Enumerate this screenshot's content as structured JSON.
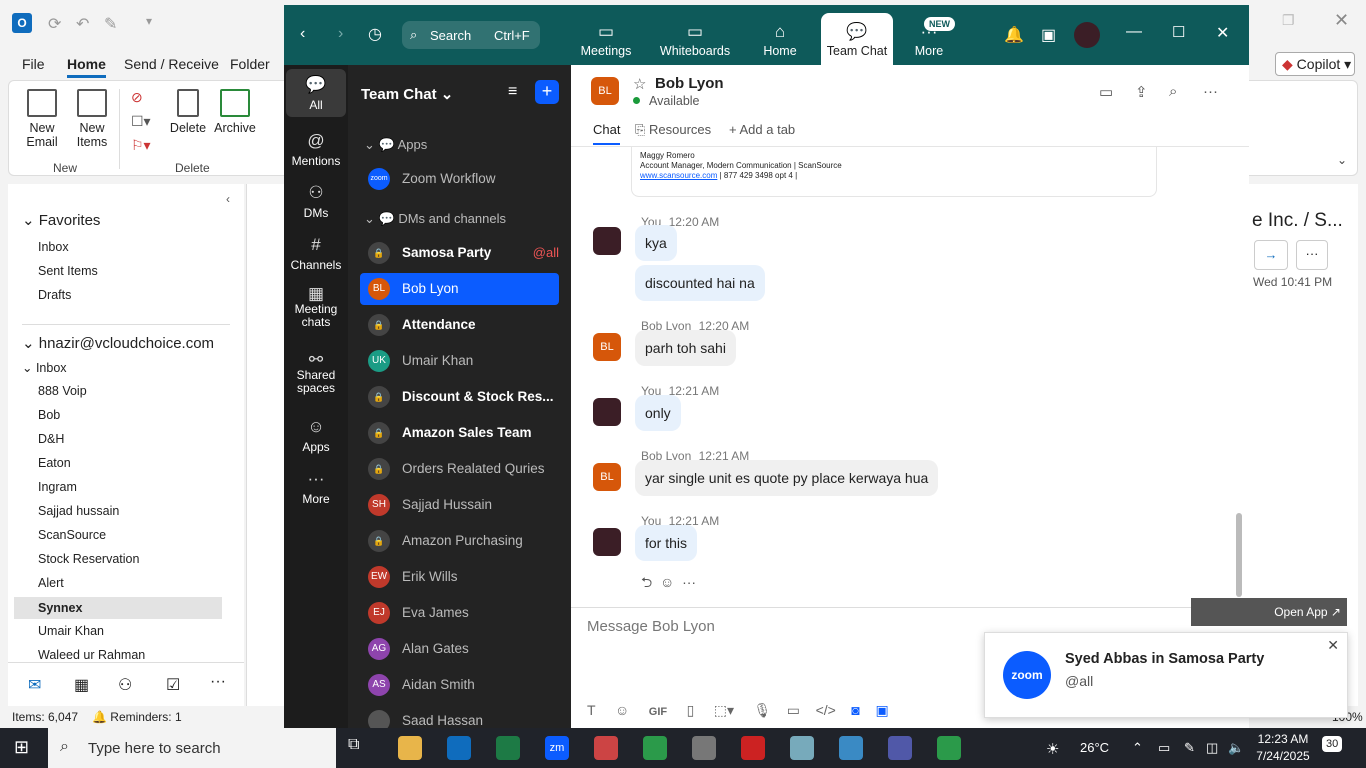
{
  "outlook": {
    "menu": [
      "File",
      "Home",
      "Send / Receive",
      "Folder"
    ],
    "ribbon": {
      "new_email": "New\nEmail",
      "new_items": "New\nItems",
      "delete": "Delete",
      "archive": "Archive",
      "group_new": "New",
      "group_delete": "Delete"
    },
    "copilot": "Copilot",
    "favorites_label": "Favorites",
    "favorites": [
      "Inbox",
      "Sent Items",
      "Drafts"
    ],
    "account": "hnazir@vcloudchoice.com",
    "inbox_label": "Inbox",
    "folders": [
      "888 Voip",
      "Bob",
      "D&H",
      "Eaton",
      "Ingram",
      "Sajjad hussain",
      "ScanSource",
      "Stock Reservation",
      "Alert",
      "Synnex",
      "Umair Khan",
      "Waleed ur Rahman"
    ],
    "selected_folder": "Synnex",
    "right_title": "e Inc. / S...",
    "right_date": "Wed 10:41 PM",
    "status_items": "Items: 6,047",
    "status_reminders": "Reminders: 1",
    "zoom_pct": "100%"
  },
  "zoom": {
    "search": "Search",
    "search_shortcut": "Ctrl+F",
    "tabs": [
      "Meetings",
      "Whiteboards",
      "Home",
      "Team Chat",
      "More"
    ],
    "new_badge": "NEW",
    "rail": [
      "All",
      "Mentions",
      "DMs",
      "Channels",
      "Meeting\nchats",
      "Shared\nspaces",
      "Apps",
      "More"
    ],
    "list_title": "Team Chat",
    "apps_section": "Apps",
    "dm_section": "DMs and channels",
    "list": [
      {
        "initials": "zoom",
        "name": "Zoom Workflow",
        "color": "#0b5cff",
        "bold": false,
        "type": "app"
      },
      {
        "initials": "",
        "name": "Samosa Party",
        "bold": true,
        "type": "lock",
        "tag": "@all"
      },
      {
        "initials": "BL",
        "name": "Bob Lyon",
        "color": "#d6570a",
        "bold": false,
        "type": "selected"
      },
      {
        "initials": "",
        "name": "Attendance",
        "bold": true,
        "type": "lock"
      },
      {
        "initials": "UK",
        "name": "Umair Khan",
        "color": "#1b9c85",
        "bold": false
      },
      {
        "initials": "",
        "name": "Discount & Stock Res...",
        "bold": true,
        "type": "lock"
      },
      {
        "initials": "",
        "name": "Amazon Sales Team",
        "bold": true,
        "type": "lock"
      },
      {
        "initials": "",
        "name": "Orders Realated Quries",
        "bold": false,
        "type": "lock"
      },
      {
        "initials": "SH",
        "name": "Sajjad Hussain",
        "color": "#c0392b",
        "bold": false
      },
      {
        "initials": "",
        "name": "Amazon Purchasing",
        "bold": false,
        "type": "lock"
      },
      {
        "initials": "EW",
        "name": "Erik Wills",
        "color": "#c0392b",
        "bold": false
      },
      {
        "initials": "EJ",
        "name": "Eva James",
        "color": "#c0392b",
        "bold": false
      },
      {
        "initials": "AG",
        "name": "Alan Gates",
        "color": "#8e44ad",
        "bold": false
      },
      {
        "initials": "AS",
        "name": "Aidan Smith",
        "color": "#8e44ad",
        "bold": false
      },
      {
        "initials": "",
        "name": "Saad Hassan",
        "color": "#555",
        "bold": false
      }
    ],
    "chat": {
      "contact_initials": "BL",
      "contact_name": "Bob Lyon",
      "presence": "Available",
      "subtabs": [
        "Chat",
        "Resources",
        "Add a tab"
      ],
      "sig_name": "Maggy Romero",
      "sig_title": "Account Manager, Modern Communication | ScanSource",
      "sig_link": "www.scansource.com",
      "sig_phone": "| 877 429 3498 opt 4 |",
      "messages": [
        {
          "from": "You",
          "time": "12:20 AM",
          "lines": [
            "kya",
            "discounted hai na"
          ]
        },
        {
          "from": "Bob Lyon",
          "time": "12:20 AM",
          "lines": [
            "parh toh sahi"
          ]
        },
        {
          "from": "You",
          "time": "12:21 AM",
          "lines": [
            "only"
          ]
        },
        {
          "from": "Bob Lyon",
          "time": "12:21 AM",
          "lines": [
            "yar single unit es quote py place kerwaya hua"
          ]
        },
        {
          "from": "You",
          "time": "12:21 AM",
          "lines": [
            "for this"
          ]
        }
      ],
      "compose_placeholder": "Message Bob Lyon",
      "gif": "GIF"
    },
    "toast": {
      "open_app": "Open App ↗",
      "logo": "zoom",
      "title": "Syed Abbas in Samosa Party",
      "body": "@all"
    }
  },
  "taskbar": {
    "search_placeholder": "Type here to search",
    "weather": "26°C",
    "time": "12:23 AM",
    "date": "7/24/2025",
    "notif_count": "30"
  }
}
